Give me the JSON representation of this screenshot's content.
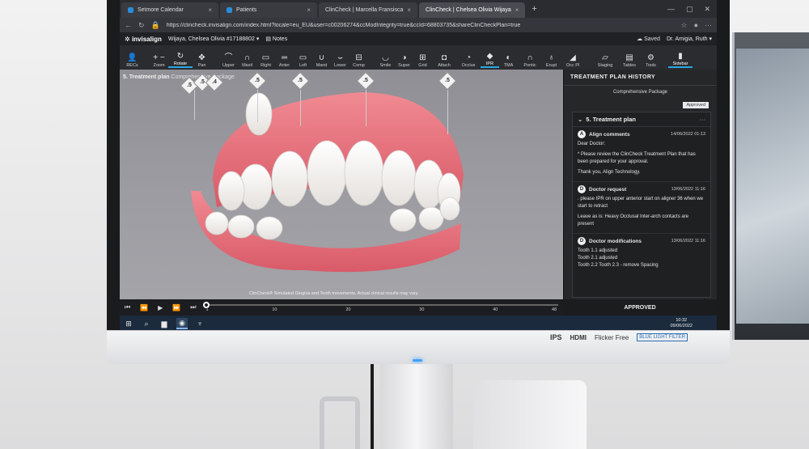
{
  "browser": {
    "tabs": [
      {
        "label": "Setmore Calendar",
        "active": false
      },
      {
        "label": "Patients",
        "active": false
      },
      {
        "label": "ClinCheck | Marcella Fransisca",
        "active": false
      },
      {
        "label": "ClinCheck | Chelsea Olivia Wijaya",
        "active": true
      }
    ],
    "new_tab": "+",
    "url": "https://clincheck.invisalign.com/index.html?locale=eu_EU&user=c00206274&ccModIntegrity=true&ccId=68803735&shareClinCheckPlan=true",
    "saved": "Saved",
    "user": "Dr. Amigia, Ruth"
  },
  "appbar": {
    "brand": "invisalign",
    "patient": "Wijaya, Chelsea Olivia #17188802",
    "notes": "Notes"
  },
  "toolbar": {
    "tools": [
      {
        "label": "RECs",
        "glyph": "👤",
        "icon": "recs-icon"
      },
      {
        "label": "Zoom",
        "glyph": "+ −",
        "icon": "zoom-icon"
      },
      {
        "label": "Rotate",
        "glyph": "↻",
        "icon": "rotate-icon",
        "selected": true
      },
      {
        "label": "Pan",
        "glyph": "✥",
        "icon": "pan-icon"
      },
      {
        "label": "Upper",
        "glyph": "⌒",
        "icon": "upper-icon"
      },
      {
        "label": "Maxil",
        "glyph": "∩",
        "icon": "maxil-icon"
      },
      {
        "label": "Right",
        "glyph": "▭",
        "icon": "right-icon"
      },
      {
        "label": "Anter",
        "glyph": "═",
        "icon": "anterior-icon"
      },
      {
        "label": "Left",
        "glyph": "▭",
        "icon": "left-icon"
      },
      {
        "label": "Mand",
        "glyph": "∪",
        "icon": "mand-icon"
      },
      {
        "label": "Lower",
        "glyph": "⌣",
        "icon": "lower-icon"
      },
      {
        "label": "Comp",
        "glyph": "⊟",
        "icon": "comp-icon"
      },
      {
        "label": "Smile",
        "glyph": "◡",
        "icon": "smile-icon"
      },
      {
        "label": "Super",
        "glyph": "◑",
        "icon": "super-icon"
      },
      {
        "label": "Grid",
        "glyph": "⊞",
        "icon": "grid-icon"
      },
      {
        "label": "Attach",
        "glyph": "◘",
        "icon": "attach-icon"
      },
      {
        "label": "Occlus",
        "glyph": "◔",
        "icon": "occlus-icon"
      },
      {
        "label": "IPR",
        "glyph": "◆",
        "icon": "ipr-icon",
        "selected": true
      },
      {
        "label": "TMA",
        "glyph": "◐",
        "icon": "tma-icon"
      },
      {
        "label": "Pontic",
        "glyph": "∩",
        "icon": "pontic-icon"
      },
      {
        "label": "Erupt",
        "glyph": "♁",
        "icon": "erupt-icon"
      },
      {
        "label": "Occ Pl",
        "glyph": "◢",
        "icon": "occ-pl-icon"
      },
      {
        "label": "Staging",
        "glyph": "▱",
        "icon": "staging-icon"
      },
      {
        "label": "Tables",
        "glyph": "▤",
        "icon": "tables-icon"
      },
      {
        "label": "Tools",
        "glyph": "⚙",
        "icon": "tools-icon"
      },
      {
        "label": "Sidebar",
        "glyph": "▮",
        "icon": "sidebar-icon",
        "selected": true
      }
    ]
  },
  "viewer": {
    "plan_title": "5. Treatment plan",
    "plan_sub": "Comprehensive Package",
    "ipr_markers": [
      ".5",
      ".5",
      ".4",
      ".5",
      ".5",
      ".5",
      ".5"
    ],
    "disclaimer": "ClinCheck® Simulated Gingiva and Tooth movements. Actual clinical results may vary."
  },
  "playback": {
    "ticks": [
      "1",
      "10",
      "20",
      "30",
      "40",
      "48"
    ],
    "progress": 0.0
  },
  "history": {
    "header": "TREATMENT PLAN HISTORY",
    "package": "Comprehensive Package",
    "status": "Approved",
    "card_title": "5. Treatment plan",
    "card_menu": "···",
    "entries": [
      {
        "badge": "A",
        "title": "Align comments",
        "date": "14/06/2022 01:13",
        "lines": [
          "Dear Doctor:",
          "* Please review the ClinCheck Treatment Plan that has been prepared for your approval.",
          "Thank you, Align Technology."
        ]
      },
      {
        "badge": "D",
        "title": "Doctor request",
        "date": "13/06/2022 11:16",
        "lines": [
          ". please IPR on upper anterior start on aligner 36 when we start to retract",
          "Leave as is: Heavy Occlusal Inter-arch contacts are present"
        ]
      },
      {
        "badge": "D",
        "title": "Doctor modifications",
        "date": "13/06/2022 11:16",
        "lines": [
          "Tooth 1.1 adjusted",
          "Tooth 2.1 adjusted",
          "Tooth 2.2 Tooth 2.3 - remove Spacing"
        ]
      }
    ],
    "footer": "APPROVED"
  },
  "taskbar": {
    "time": "10:32",
    "date": "09/06/2022"
  },
  "monitor_logos": [
    "IPS",
    "HDMI",
    "Flicker Free",
    "BLUE LIGHT FILTER"
  ]
}
